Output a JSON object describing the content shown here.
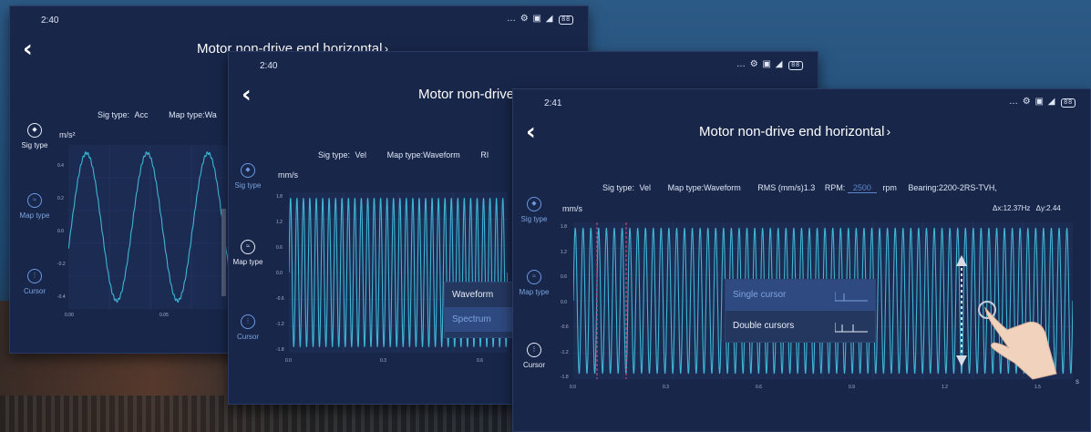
{
  "screens": [
    {
      "status": {
        "time": "2:40"
      },
      "title": "Motor non-drive end horizontal",
      "info": {
        "sig_type_label": "Sig type:",
        "sig_type_value": "Acc",
        "map_type_label": "Map type:Wa"
      },
      "side": {
        "sig_type": "Sig type",
        "map_type": "Map type",
        "cursor": "Cursor"
      },
      "unit": "m/s²",
      "yticks": [
        "0.4",
        "0.2",
        "0.0",
        "-0.2",
        "-0.4"
      ],
      "xticks": [
        "0.00",
        "0.05"
      ]
    },
    {
      "status": {
        "time": "2:40"
      },
      "title": "Motor non-drive end horizontal",
      "info": {
        "sig_type_label": "Sig type:",
        "sig_type_value": "Vel",
        "map_type_label": "Map type:Waveform",
        "extra": "RI"
      },
      "side": {
        "sig_type": "Sig type",
        "map_type": "Map type",
        "cursor": "Cursor"
      },
      "unit": "mm/s",
      "yticks": [
        "1.8",
        "1.2",
        "0.6",
        "0.0",
        "-0.6",
        "-1.2",
        "-1.8"
      ],
      "xticks": [
        "0.0",
        "0.3",
        "0.6"
      ],
      "menu": {
        "waveform": "Waveform",
        "spectrum": "Spectrum"
      }
    },
    {
      "status": {
        "time": "2:41"
      },
      "title": "Motor non-drive end horizontal",
      "info": {
        "sig_type_label": "Sig type:",
        "sig_type_value": "Vel",
        "map_type_label": "Map type:Waveform",
        "rms": "RMS (mm/s)1.3",
        "rpm_label": "RPM:",
        "rpm_value": "2500",
        "rpm_unit": "rpm",
        "bearing": "Bearing:2200-2RS-TVH,"
      },
      "delta": {
        "dx": "Δx:12.37Hz",
        "dy": "Δy:2.44"
      },
      "side": {
        "sig_type": "Sig type",
        "map_type": "Map type",
        "cursor": "Cursor"
      },
      "unit": "mm/s",
      "yticks": [
        "1.8",
        "1.2",
        "0.6",
        "0.0",
        "-0.6",
        "-1.2",
        "-1.8"
      ],
      "xticks": [
        "0.0",
        "0.3",
        "0.6",
        "0.9",
        "1.2",
        "1.5"
      ],
      "x_end_label": "s",
      "menu": {
        "single_cursor": "Single cursor",
        "double_cursors": "Double cursors"
      }
    }
  ],
  "colors": {
    "wave": "#3fb6d4",
    "accent": "#6b9ae0",
    "cursor_line": "#c0487a"
  }
}
